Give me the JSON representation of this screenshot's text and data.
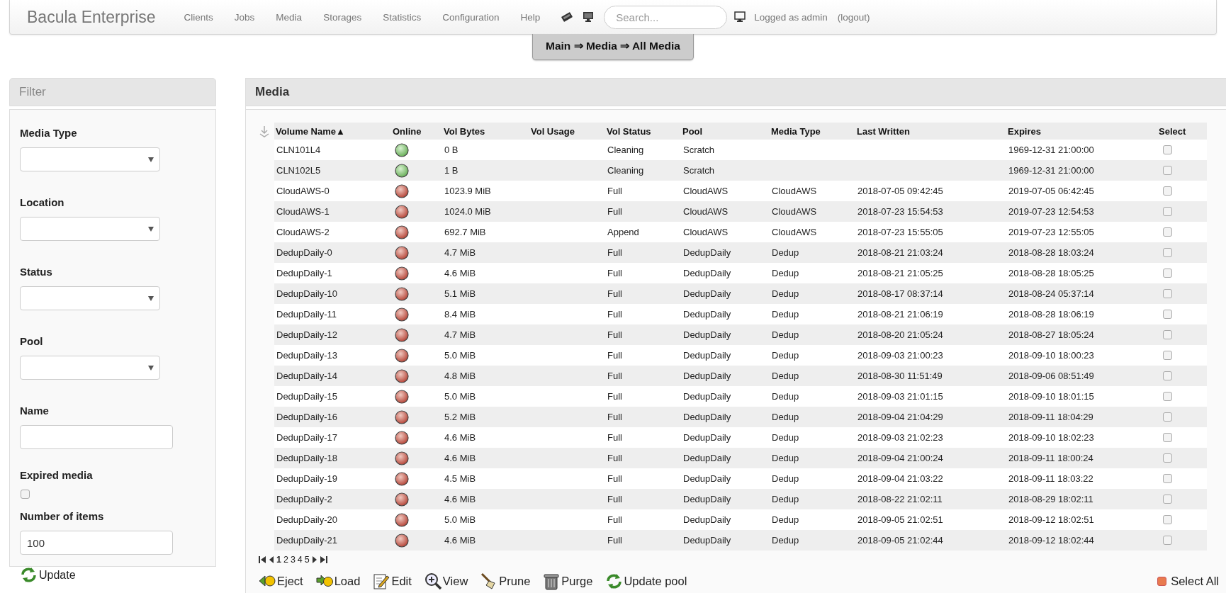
{
  "navbar": {
    "brand": "Bacula Enterprise",
    "menu": [
      "Clients",
      "Jobs",
      "Media",
      "Storages",
      "Statistics",
      "Configuration",
      "Help"
    ],
    "search": {
      "placeholder": "Search..."
    },
    "user_text": "Logged as admin",
    "logout": "(logout)"
  },
  "breadcrumb": "Main ⇒ Media ⇒ All Media",
  "filter": {
    "title": "Filter",
    "fields": [
      {
        "kind": "select",
        "label": "Media Type"
      },
      {
        "kind": "select",
        "label": "Location"
      },
      {
        "kind": "select",
        "label": "Status"
      },
      {
        "kind": "select",
        "label": "Pool"
      },
      {
        "kind": "text",
        "label": "Name"
      },
      {
        "kind": "checkbox",
        "label": "Expired media",
        "checked": false
      },
      {
        "kind": "text",
        "label": "Number of items",
        "value": "100"
      }
    ],
    "update_button": "Update"
  },
  "media": {
    "title": "Media",
    "columns": [
      "Volume Name▲",
      "Online",
      "Vol Bytes",
      "Vol Usage",
      "Vol Status",
      "Pool",
      "Media Type",
      "Last Written",
      "Expires",
      "Select"
    ],
    "rows": [
      {
        "name": "CLN101L4",
        "online": true,
        "bytes": "0 B",
        "status": "Cleaning",
        "pool": "Scratch",
        "expires": "1969-12-31 21:00:00",
        "checked": false
      },
      {
        "name": "CLN102L5",
        "online": true,
        "bytes": "1 B",
        "status": "Cleaning",
        "pool": "Scratch",
        "expires": "1969-12-31 21:00:00",
        "checked": false
      },
      {
        "name": "CloudAWS-0",
        "online": false,
        "bytes": "1023.9 MiB",
        "status": "Full",
        "pool": "CloudAWS",
        "media_type": "CloudAWS",
        "last_written": "2018-07-05 09:42:45",
        "expires": "2019-07-05 06:42:45",
        "checked": false
      },
      {
        "name": "CloudAWS-1",
        "online": false,
        "bytes": "1024.0 MiB",
        "status": "Full",
        "pool": "CloudAWS",
        "media_type": "CloudAWS",
        "last_written": "2018-07-23 15:54:53",
        "expires": "2019-07-23 12:54:53",
        "checked": false
      },
      {
        "name": "CloudAWS-2",
        "online": false,
        "bytes": "692.7 MiB",
        "status": "Append",
        "pool": "CloudAWS",
        "media_type": "CloudAWS",
        "last_written": "2018-07-23 15:55:05",
        "expires": "2019-07-23 12:55:05",
        "checked": false
      },
      {
        "name": "DedupDaily-0",
        "online": false,
        "bytes": "4.7 MiB",
        "status": "Full",
        "pool": "DedupDaily",
        "media_type": "Dedup",
        "last_written": "2018-08-21 21:03:24",
        "expires": "2018-08-28 18:03:24",
        "checked": false
      },
      {
        "name": "DedupDaily-1",
        "online": false,
        "bytes": "4.6 MiB",
        "status": "Full",
        "pool": "DedupDaily",
        "media_type": "Dedup",
        "last_written": "2018-08-21 21:05:25",
        "expires": "2018-08-28 18:05:25",
        "checked": false
      },
      {
        "name": "DedupDaily-10",
        "online": false,
        "bytes": "5.1 MiB",
        "status": "Full",
        "pool": "DedupDaily",
        "media_type": "Dedup",
        "last_written": "2018-08-17 08:37:14",
        "expires": "2018-08-24 05:37:14",
        "checked": false
      },
      {
        "name": "DedupDaily-11",
        "online": false,
        "bytes": "8.4 MiB",
        "status": "Full",
        "pool": "DedupDaily",
        "media_type": "Dedup",
        "last_written": "2018-08-21 21:06:19",
        "expires": "2018-08-28 18:06:19",
        "checked": false
      },
      {
        "name": "DedupDaily-12",
        "online": false,
        "bytes": "4.7 MiB",
        "status": "Full",
        "pool": "DedupDaily",
        "media_type": "Dedup",
        "last_written": "2018-08-20 21:05:24",
        "expires": "2018-08-27 18:05:24",
        "checked": false
      },
      {
        "name": "DedupDaily-13",
        "online": false,
        "bytes": "5.0 MiB",
        "status": "Full",
        "pool": "DedupDaily",
        "media_type": "Dedup",
        "last_written": "2018-09-03 21:00:23",
        "expires": "2018-09-10 18:00:23",
        "checked": false
      },
      {
        "name": "DedupDaily-14",
        "online": false,
        "bytes": "4.8 MiB",
        "status": "Full",
        "pool": "DedupDaily",
        "media_type": "Dedup",
        "last_written": "2018-08-30 11:51:49",
        "expires": "2018-09-06 08:51:49",
        "checked": false
      },
      {
        "name": "DedupDaily-15",
        "online": false,
        "bytes": "5.0 MiB",
        "status": "Full",
        "pool": "DedupDaily",
        "media_type": "Dedup",
        "last_written": "2018-09-03 21:01:15",
        "expires": "2018-09-10 18:01:15",
        "checked": false
      },
      {
        "name": "DedupDaily-16",
        "online": false,
        "bytes": "5.2 MiB",
        "status": "Full",
        "pool": "DedupDaily",
        "media_type": "Dedup",
        "last_written": "2018-09-04 21:04:29",
        "expires": "2018-09-11 18:04:29",
        "checked": false
      },
      {
        "name": "DedupDaily-17",
        "online": false,
        "bytes": "4.6 MiB",
        "status": "Full",
        "pool": "DedupDaily",
        "media_type": "Dedup",
        "last_written": "2018-09-03 21:02:23",
        "expires": "2018-09-10 18:02:23",
        "checked": false
      },
      {
        "name": "DedupDaily-18",
        "online": false,
        "bytes": "4.6 MiB",
        "status": "Full",
        "pool": "DedupDaily",
        "media_type": "Dedup",
        "last_written": "2018-09-04 21:00:24",
        "expires": "2018-09-11 18:00:24",
        "checked": false
      },
      {
        "name": "DedupDaily-19",
        "online": false,
        "bytes": "4.5 MiB",
        "status": "Full",
        "pool": "DedupDaily",
        "media_type": "Dedup",
        "last_written": "2018-09-04 21:03:22",
        "expires": "2018-09-11 18:03:22",
        "checked": false
      },
      {
        "name": "DedupDaily-2",
        "online": false,
        "bytes": "4.6 MiB",
        "status": "Full",
        "pool": "DedupDaily",
        "media_type": "Dedup",
        "last_written": "2018-08-22 21:02:11",
        "expires": "2018-08-29 18:02:11",
        "checked": false
      },
      {
        "name": "DedupDaily-20",
        "online": false,
        "bytes": "5.0 MiB",
        "status": "Full",
        "pool": "DedupDaily",
        "media_type": "Dedup",
        "last_written": "2018-09-05 21:02:51",
        "expires": "2018-09-12 18:02:51",
        "checked": false
      },
      {
        "name": "DedupDaily-21",
        "online": false,
        "bytes": "4.6 MiB",
        "status": "Full",
        "pool": "DedupDaily",
        "media_type": "Dedup",
        "last_written": "2018-09-05 21:02:44",
        "expires": "2018-09-12 18:02:44",
        "checked": false
      }
    ],
    "pages": [
      {
        "label": "1",
        "selected": true
      },
      {
        "label": "2",
        "selected": false
      },
      {
        "label": "3",
        "selected": false
      },
      {
        "label": "4",
        "selected": false
      },
      {
        "label": "5",
        "selected": false
      }
    ],
    "actions": [
      {
        "kind": "eject",
        "label": "Eject"
      },
      {
        "kind": "load",
        "label": "Load"
      },
      {
        "kind": "edit",
        "label": "Edit"
      },
      {
        "kind": "view",
        "label": "View"
      },
      {
        "kind": "prune",
        "label": "Prune"
      },
      {
        "kind": "purge",
        "label": "Purge"
      },
      {
        "kind": "update",
        "label": "Update pool"
      }
    ],
    "select_all": {
      "label": "Select All",
      "checked": true
    }
  }
}
